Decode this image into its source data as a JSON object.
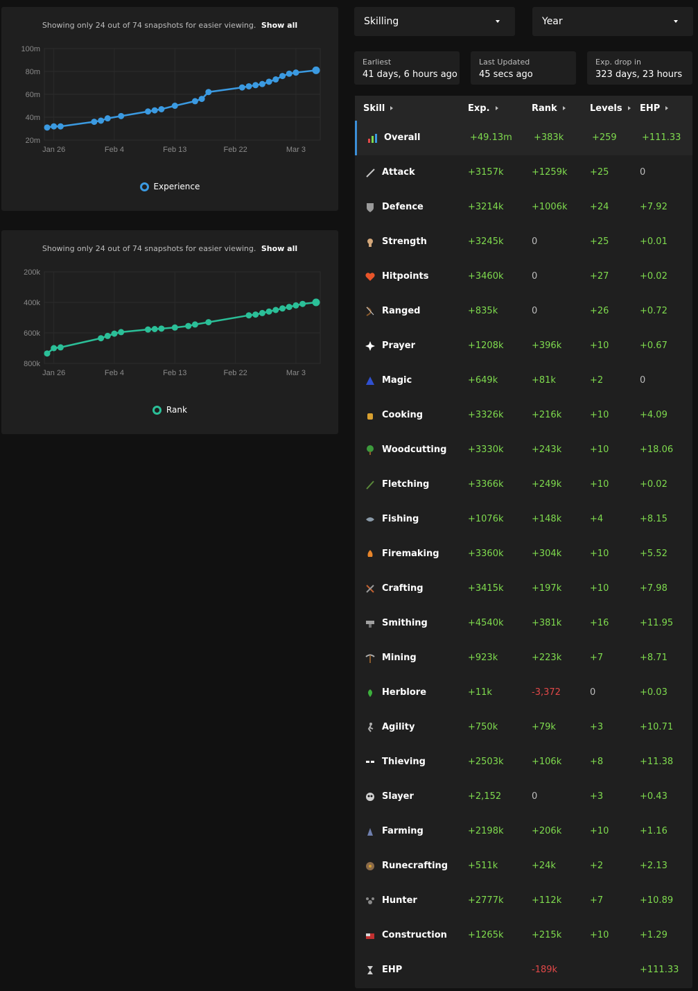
{
  "colors": {
    "experience": "#3b9ae1",
    "rank": "#2bbf98",
    "positive": "#7fdb4e",
    "negative": "#e14848",
    "neutral": "#bdbdbd"
  },
  "charts": {
    "note": "Showing only 24 out of 74 snapshots for easier viewing.",
    "show_all": "Show all"
  },
  "chart_data": [
    {
      "type": "line",
      "xlabel": "",
      "ylabel": "",
      "x": [
        "Jan 25",
        "Jan 26",
        "Jan 27",
        "Feb 1",
        "Feb 2",
        "Feb 3",
        "Feb 5",
        "Feb 9",
        "Feb 10",
        "Feb 11",
        "Feb 13",
        "Feb 16",
        "Feb 17",
        "Feb 18",
        "Feb 23",
        "Feb 24",
        "Feb 25",
        "Feb 26",
        "Feb 27",
        "Feb 28",
        "Mar 1",
        "Mar 2",
        "Mar 3",
        "Mar 6"
      ],
      "series": [
        {
          "name": "Experience",
          "values": [
            31,
            32,
            32,
            36,
            37,
            39,
            41,
            45,
            46,
            47,
            50,
            54,
            56,
            62,
            66,
            67,
            68,
            69,
            71,
            73,
            76,
            78,
            79,
            81
          ]
        }
      ],
      "y_unit": "m",
      "ylim": [
        20,
        100
      ],
      "yticks": [
        "100m",
        "80m",
        "60m",
        "40m",
        "20m"
      ],
      "xticks": [
        "Jan 26",
        "Feb 4",
        "Feb 13",
        "Feb 22",
        "Mar 3"
      ],
      "grid": true,
      "legend": "bottom"
    },
    {
      "type": "line",
      "xlabel": "",
      "ylabel": "",
      "x": [
        "Jan 25",
        "Jan 26",
        "Jan 27",
        "Feb 2",
        "Feb 3",
        "Feb 4",
        "Feb 5",
        "Feb 9",
        "Feb 10",
        "Feb 11",
        "Feb 13",
        "Feb 15",
        "Feb 16",
        "Feb 18",
        "Feb 24",
        "Feb 25",
        "Feb 26",
        "Feb 27",
        "Feb 28",
        "Mar 1",
        "Mar 2",
        "Mar 3",
        "Mar 4",
        "Mar 6"
      ],
      "series": [
        {
          "name": "Rank",
          "values": [
            735,
            700,
            695,
            635,
            620,
            605,
            595,
            578,
            575,
            572,
            565,
            555,
            545,
            530,
            485,
            480,
            470,
            460,
            450,
            440,
            430,
            420,
            410,
            400
          ]
        }
      ],
      "y_unit": "k",
      "ylim": [
        800,
        200
      ],
      "reversed_y": true,
      "yticks": [
        "200k",
        "400k",
        "600k",
        "800k"
      ],
      "xticks": [
        "Jan 26",
        "Feb 4",
        "Feb 13",
        "Feb 22",
        "Mar 3"
      ],
      "grid": true,
      "legend": "bottom"
    }
  ],
  "filters": {
    "metric": "Skilling",
    "period": "Year"
  },
  "stats": [
    {
      "title": "Earliest",
      "value": "41 days, 6 hours ago"
    },
    {
      "title": "Last Updated",
      "value": "45 secs ago"
    },
    {
      "title": "Exp. drop in",
      "value": "323 days, 23 hours"
    }
  ],
  "table": {
    "headers": {
      "skill": "Skill",
      "exp": "Exp.",
      "rank": "Rank",
      "levels": "Levels",
      "ehp": "EHP"
    },
    "rows": [
      {
        "icon": "overall-icon",
        "skill": "Overall",
        "exp": "+49.13m",
        "rank": "+383k",
        "levels": "+259",
        "ehp": "+111.33"
      },
      {
        "icon": "attack-icon",
        "skill": "Attack",
        "exp": "+3157k",
        "rank": "+1259k",
        "levels": "+25",
        "ehp": "0"
      },
      {
        "icon": "defence-icon",
        "skill": "Defence",
        "exp": "+3214k",
        "rank": "+1006k",
        "levels": "+24",
        "ehp": "+7.92"
      },
      {
        "icon": "strength-icon",
        "skill": "Strength",
        "exp": "+3245k",
        "rank": "0",
        "levels": "+25",
        "ehp": "+0.01"
      },
      {
        "icon": "hitpoints-icon",
        "skill": "Hitpoints",
        "exp": "+3460k",
        "rank": "0",
        "levels": "+27",
        "ehp": "+0.02"
      },
      {
        "icon": "ranged-icon",
        "skill": "Ranged",
        "exp": "+835k",
        "rank": "0",
        "levels": "+26",
        "ehp": "+0.72"
      },
      {
        "icon": "prayer-icon",
        "skill": "Prayer",
        "exp": "+1208k",
        "rank": "+396k",
        "levels": "+10",
        "ehp": "+0.67"
      },
      {
        "icon": "magic-icon",
        "skill": "Magic",
        "exp": "+649k",
        "rank": "+81k",
        "levels": "+2",
        "ehp": "0"
      },
      {
        "icon": "cooking-icon",
        "skill": "Cooking",
        "exp": "+3326k",
        "rank": "+216k",
        "levels": "+10",
        "ehp": "+4.09"
      },
      {
        "icon": "woodcutting-icon",
        "skill": "Woodcutting",
        "exp": "+3330k",
        "rank": "+243k",
        "levels": "+10",
        "ehp": "+18.06"
      },
      {
        "icon": "fletching-icon",
        "skill": "Fletching",
        "exp": "+3366k",
        "rank": "+249k",
        "levels": "+10",
        "ehp": "+0.02"
      },
      {
        "icon": "fishing-icon",
        "skill": "Fishing",
        "exp": "+1076k",
        "rank": "+148k",
        "levels": "+4",
        "ehp": "+8.15"
      },
      {
        "icon": "firemaking-icon",
        "skill": "Firemaking",
        "exp": "+3360k",
        "rank": "+304k",
        "levels": "+10",
        "ehp": "+5.52"
      },
      {
        "icon": "crafting-icon",
        "skill": "Crafting",
        "exp": "+3415k",
        "rank": "+197k",
        "levels": "+10",
        "ehp": "+7.98"
      },
      {
        "icon": "smithing-icon",
        "skill": "Smithing",
        "exp": "+4540k",
        "rank": "+381k",
        "levels": "+16",
        "ehp": "+11.95"
      },
      {
        "icon": "mining-icon",
        "skill": "Mining",
        "exp": "+923k",
        "rank": "+223k",
        "levels": "+7",
        "ehp": "+8.71"
      },
      {
        "icon": "herblore-icon",
        "skill": "Herblore",
        "exp": "+11k",
        "rank": "-3,372",
        "levels": "0",
        "ehp": "+0.03"
      },
      {
        "icon": "agility-icon",
        "skill": "Agility",
        "exp": "+750k",
        "rank": "+79k",
        "levels": "+3",
        "ehp": "+10.71"
      },
      {
        "icon": "thieving-icon",
        "skill": "Thieving",
        "exp": "+2503k",
        "rank": "+106k",
        "levels": "+8",
        "ehp": "+11.38"
      },
      {
        "icon": "slayer-icon",
        "skill": "Slayer",
        "exp": "+2,152",
        "rank": "0",
        "levels": "+3",
        "ehp": "+0.43"
      },
      {
        "icon": "farming-icon",
        "skill": "Farming",
        "exp": "+2198k",
        "rank": "+206k",
        "levels": "+10",
        "ehp": "+1.16"
      },
      {
        "icon": "runecrafting-icon",
        "skill": "Runecrafting",
        "exp": "+511k",
        "rank": "+24k",
        "levels": "+2",
        "ehp": "+2.13"
      },
      {
        "icon": "hunter-icon",
        "skill": "Hunter",
        "exp": "+2777k",
        "rank": "+112k",
        "levels": "+7",
        "ehp": "+10.89"
      },
      {
        "icon": "construction-icon",
        "skill": "Construction",
        "exp": "+1265k",
        "rank": "+215k",
        "levels": "+10",
        "ehp": "+1.29"
      },
      {
        "icon": "ehp-icon",
        "skill": "EHP",
        "exp": "",
        "rank": "-189k",
        "levels": "",
        "ehp": "+111.33"
      }
    ]
  }
}
